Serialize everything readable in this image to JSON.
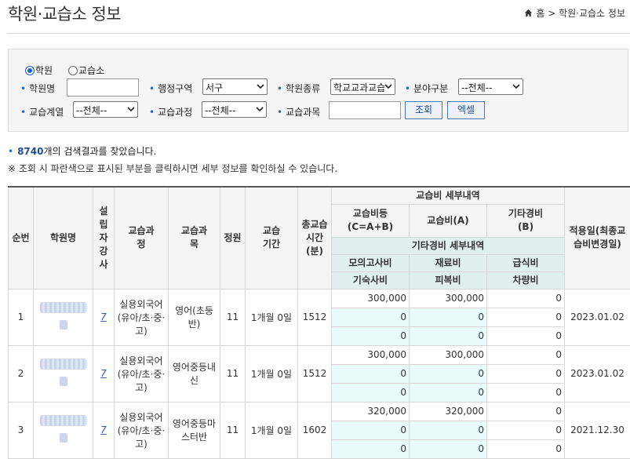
{
  "page": {
    "title": "학원·교습소 정보"
  },
  "breadcrumb": {
    "home": "홈",
    "sep": ">",
    "current": "학원·교습소 정보"
  },
  "search": {
    "radio": [
      {
        "label": "학원",
        "checked": true
      },
      {
        "label": "교습소",
        "checked": false
      }
    ],
    "academy_name_label": "학원명",
    "academy_name_value": "",
    "district_label": "행정구역",
    "district_value": "서구",
    "type_label": "학원종류",
    "type_value": "학교교과교습",
    "field_label": "분야구분",
    "field_value": "--전체--",
    "series_label": "교습계열",
    "series_value": "--전체--",
    "course_label": "교습과정",
    "course_value": "--전체--",
    "subject_label": "교습과목",
    "subject_value": "",
    "search_button": "조회",
    "excel_button": "엑셀"
  },
  "result": {
    "count": "8740",
    "suffix": "개의 검색결과를 찾았습니다."
  },
  "note": "※ 조회 시 파란색으로 표시된 부분을 클릭하시면 세부 정보를 확인하실 수 있습니다.",
  "table": {
    "headers": {
      "no": "순번",
      "name": "학원명",
      "instructors": "설립자강사",
      "course": "교습과정",
      "subject": "교습과목",
      "capacity": "정원",
      "period": "교습기간",
      "hours": "총교습시간(분)",
      "fee_detail": "교습비 세부내역",
      "total": "교습비등(C=A+B)",
      "fee_a": "교습비(A)",
      "other_b": "기타경비(B)",
      "other_detail": "기타경비 세부내역",
      "mock": "모의고사비",
      "material": "재료비",
      "meal": "급식비",
      "dorm": "기숙사비",
      "uniform": "피복비",
      "vehicle": "차량비",
      "date": "적용일(최종교습비변경일)"
    },
    "rows": [
      {
        "no": "1",
        "instructors": "7",
        "course": "실용외국어(유아/초·중·고)",
        "subject": "영어(초등반)",
        "capacity": "11",
        "period": "1개월 0일",
        "hours": "1512",
        "fees": [
          [
            "300,000",
            "300,000",
            "0"
          ],
          [
            "0",
            "0",
            "0"
          ],
          [
            "0",
            "0",
            "0"
          ]
        ],
        "date": "2023.01.02"
      },
      {
        "no": "2",
        "instructors": "7",
        "course": "실용외국어(유아/초·중·고)",
        "subject": "영어중등내신",
        "capacity": "11",
        "period": "1개월 0일",
        "hours": "1512",
        "fees": [
          [
            "300,000",
            "300,000",
            "0"
          ],
          [
            "0",
            "0",
            "0"
          ],
          [
            "0",
            "0",
            "0"
          ]
        ],
        "date": "2023.01.02"
      },
      {
        "no": "3",
        "instructors": "7",
        "course": "실용외국어(유아/초·중·고)",
        "subject": "영어중등마스터반",
        "capacity": "11",
        "period": "1개월 0일",
        "hours": "1602",
        "fees": [
          [
            "320,000",
            "320,000",
            "0"
          ],
          [
            "0",
            "0",
            "0"
          ],
          [
            "0",
            "0",
            "0"
          ]
        ],
        "date": "2021.12.30"
      }
    ]
  }
}
